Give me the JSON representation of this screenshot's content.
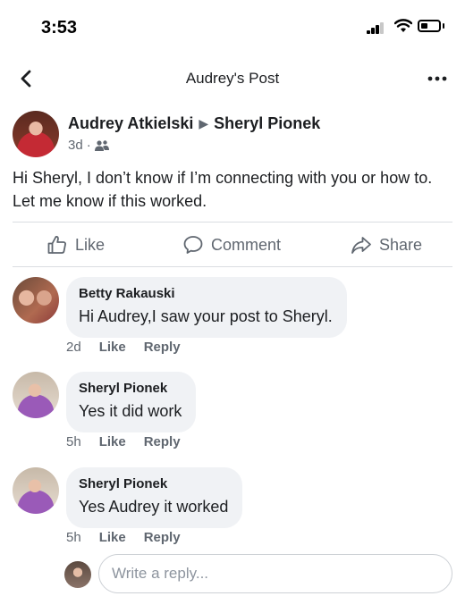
{
  "status_bar": {
    "time": "3:53"
  },
  "header": {
    "title": "Audrey's Post",
    "back_icon": "chevron-left-icon",
    "more_icon": "more-dots-icon"
  },
  "post": {
    "author": "Audrey Atkielski",
    "recipient": "Sheryl Pionek",
    "time": "3d",
    "separator": "·",
    "audience_icon": "friends-icon",
    "text": "Hi Sheryl,  I don’t know if I’m connecting with you or how to. Let me know if this worked."
  },
  "actions": {
    "like": "Like",
    "comment": "Comment",
    "share": "Share"
  },
  "comments": [
    {
      "name": "Betty Rakauski",
      "text": "Hi Audrey,I saw your post to Sheryl.",
      "time": "2d",
      "like": "Like",
      "reply": "Reply"
    },
    {
      "name": "Sheryl Pionek",
      "text": "Yes it did work",
      "time": "5h",
      "like": "Like",
      "reply": "Reply"
    },
    {
      "name": "Sheryl Pionek",
      "text": "Yes Audrey it worked",
      "time": "5h",
      "like": "Like",
      "reply": "Reply"
    }
  ],
  "reply": {
    "placeholder": "Write a reply..."
  },
  "colors": {
    "text": "#1c1e21",
    "secondary": "#606770",
    "bubble": "#f0f2f5",
    "divider": "#dadde1"
  }
}
